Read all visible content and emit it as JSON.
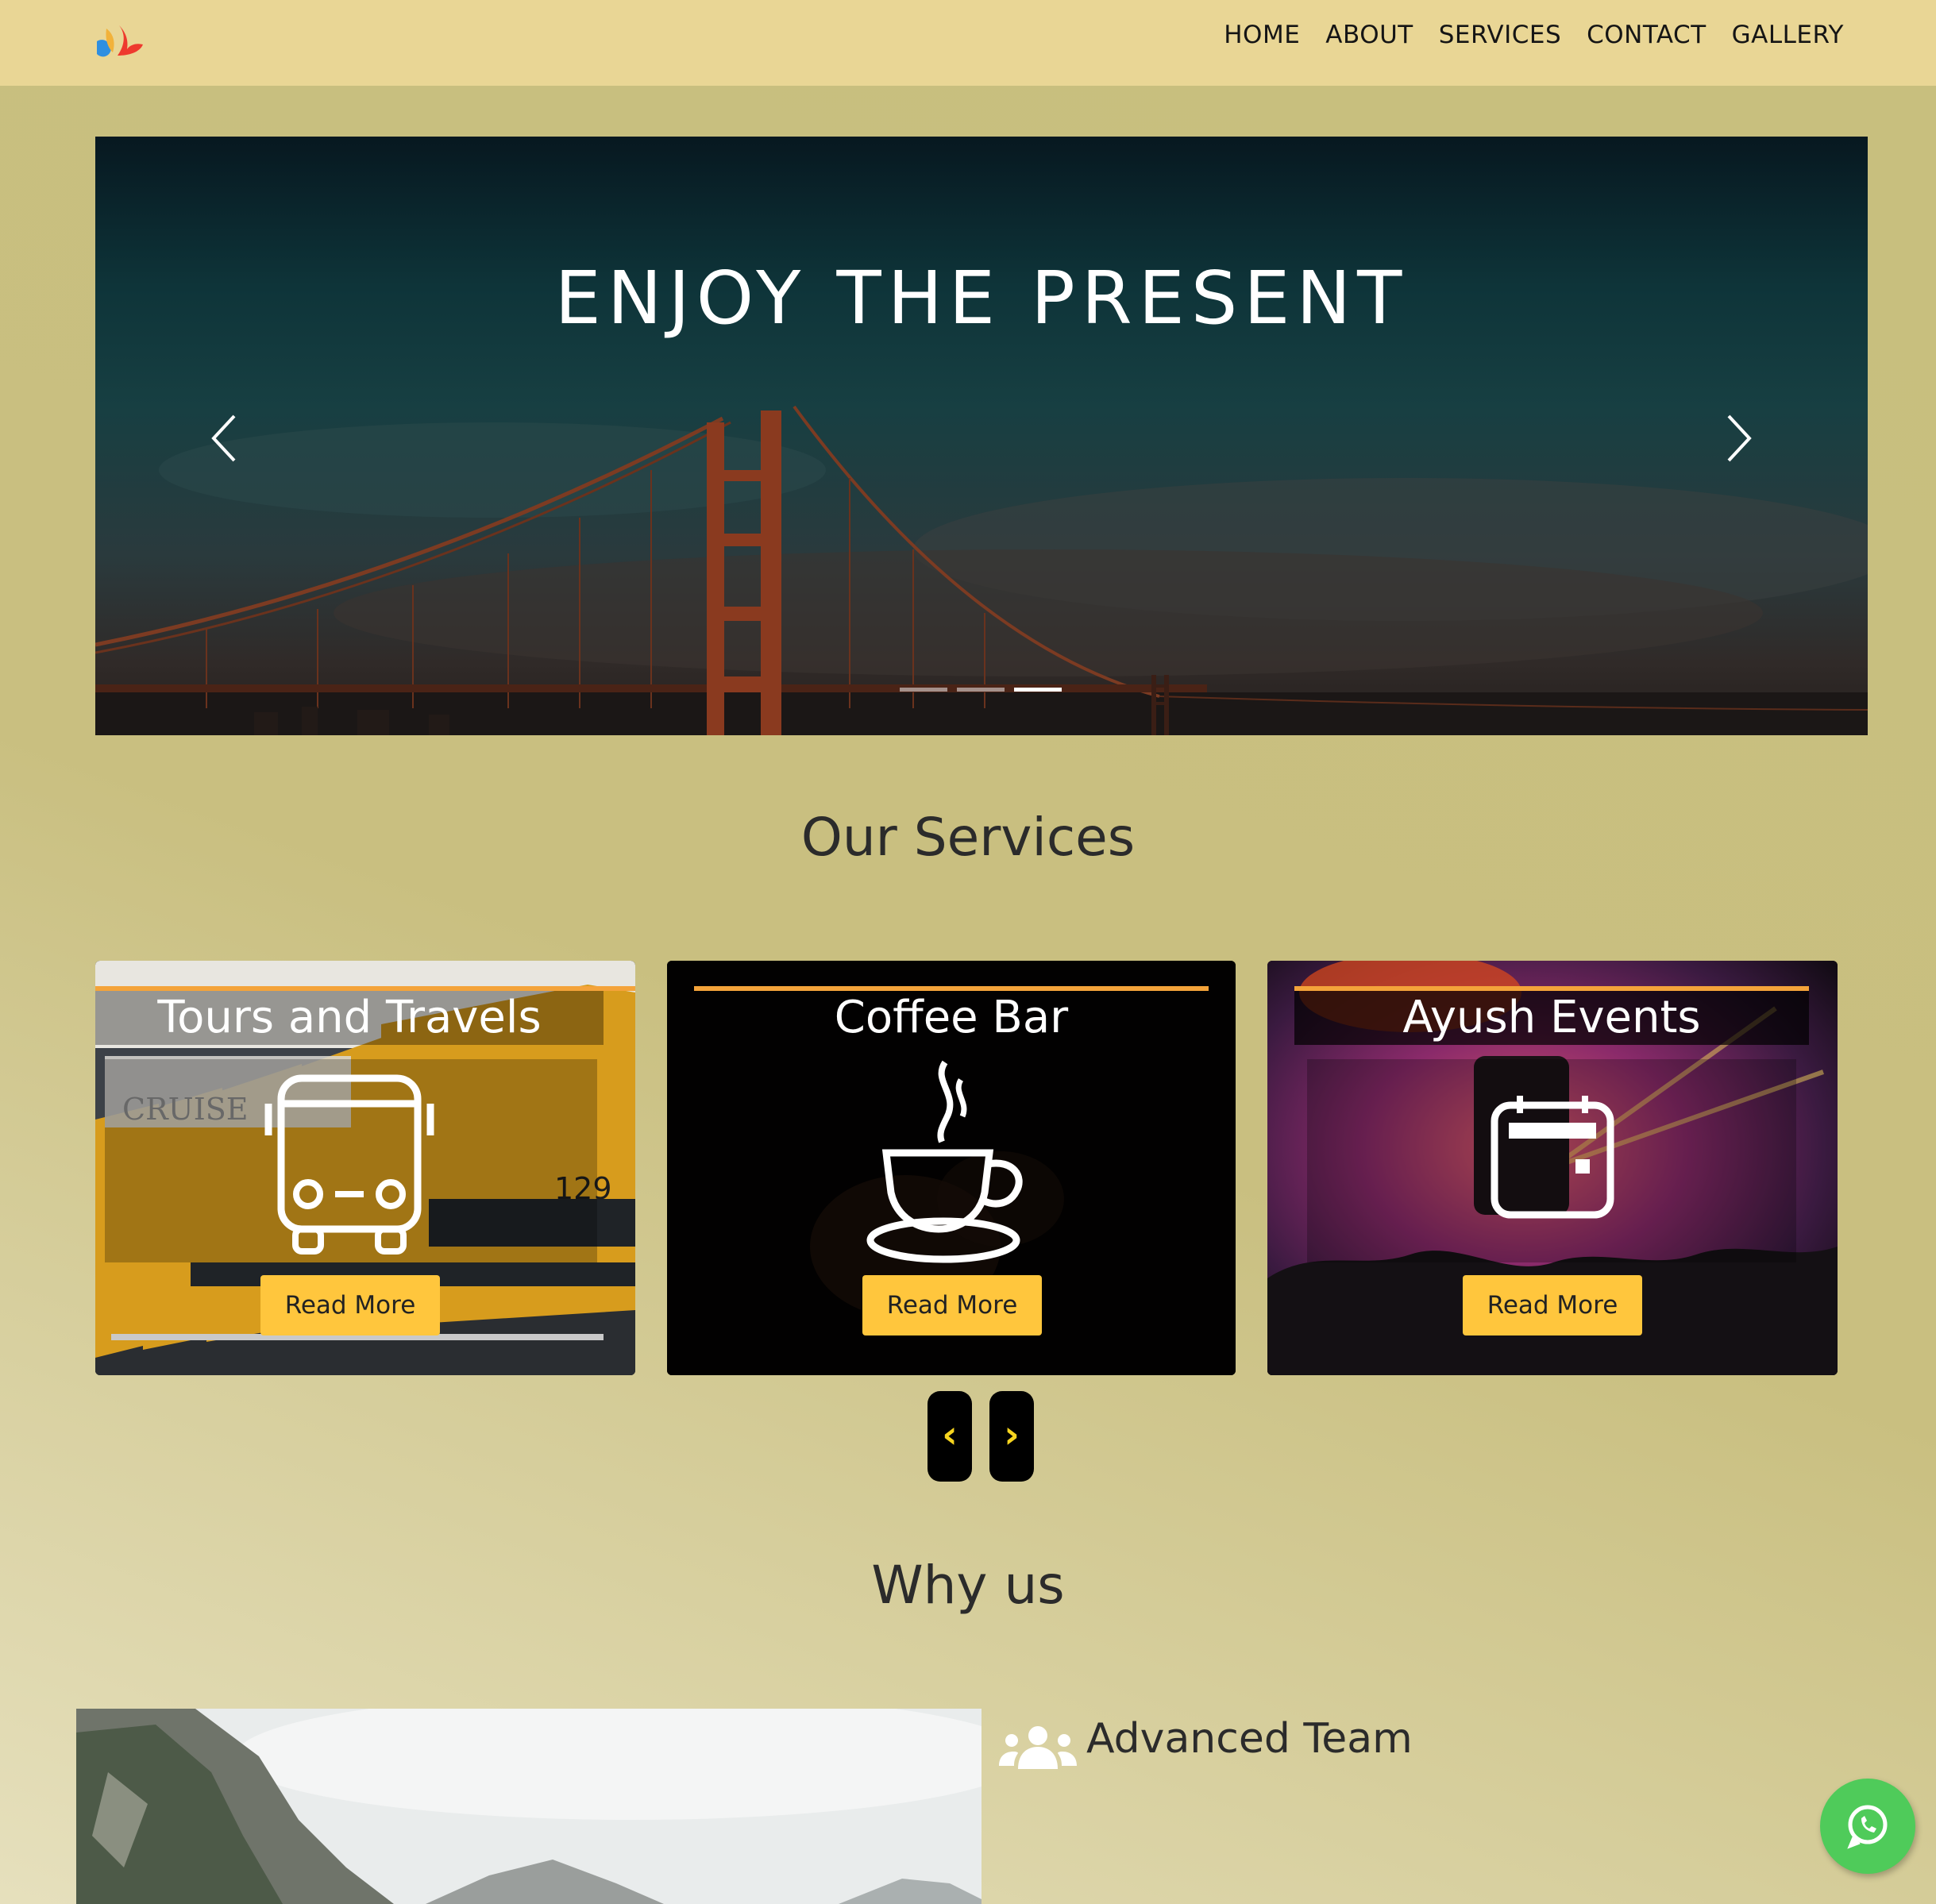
{
  "nav": {
    "items": [
      "HOME",
      "ABOUT",
      "SERVICES",
      "CONTACT",
      "GALLERY"
    ]
  },
  "hero": {
    "title": "ENJOY THE PRESENT",
    "slide_count": 3,
    "active_slide": 3
  },
  "services": {
    "heading": "Our Services",
    "cards": [
      {
        "title": "Tours and Travels",
        "icon": "bus-icon",
        "button": "Read More"
      },
      {
        "title": "Coffee Bar",
        "icon": "coffee-cup-icon",
        "button": "Read More"
      },
      {
        "title": "Ayush Events",
        "icon": "calendar-icon",
        "button": "Read More"
      }
    ],
    "prev_label": "‹",
    "next_label": "›"
  },
  "why": {
    "heading": "Why us",
    "feature_title": "Advanced Team",
    "feature_icon": "users-icon"
  },
  "colors": {
    "navbar": "#e9d695",
    "accent_rule": "#f4a33a",
    "button": "#ffc63d",
    "whatsapp": "#4fcb5a"
  }
}
